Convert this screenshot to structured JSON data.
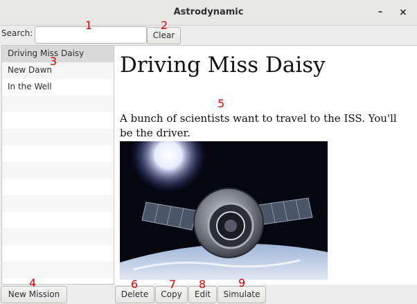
{
  "window": {
    "title": "Astrodynamic",
    "minimize_glyph": "–",
    "close_glyph": "×"
  },
  "search": {
    "label": "Search:",
    "value": "",
    "placeholder": "",
    "clear_label": "Clear"
  },
  "missions": [
    {
      "label": "Driving Miss Daisy",
      "selected": true
    },
    {
      "label": "New Dawn",
      "selected": false
    },
    {
      "label": "In the Well",
      "selected": false
    }
  ],
  "detail": {
    "title": "Driving Miss Daisy",
    "description": "A bunch of scientists want to travel to the ISS. You'll be the driver.",
    "image_icon": "spacecraft-photo"
  },
  "buttons": {
    "new_mission": "New Mission",
    "delete": "Delete",
    "copy": "Copy",
    "edit": "Edit",
    "simulate": "Simulate"
  },
  "annotations": [
    "1",
    "2",
    "3",
    "4",
    "5",
    "6",
    "7",
    "8",
    "9"
  ],
  "colors": {
    "selected_row": "#d9d9d9",
    "annotation": "#e00000"
  }
}
